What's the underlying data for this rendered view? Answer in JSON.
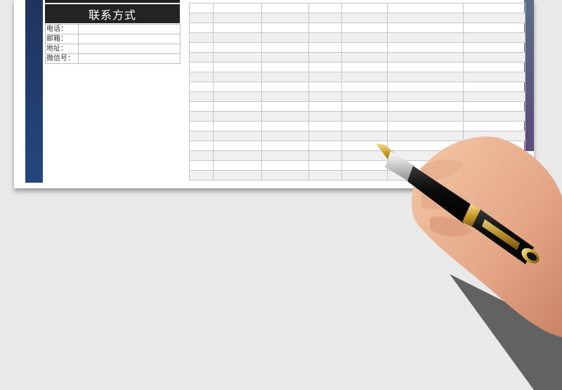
{
  "contact": {
    "title": "联系方式",
    "rows": [
      {
        "label": "电话："
      },
      {
        "label": "邮箱："
      },
      {
        "label": "地址："
      },
      {
        "label": "微信号："
      }
    ]
  }
}
